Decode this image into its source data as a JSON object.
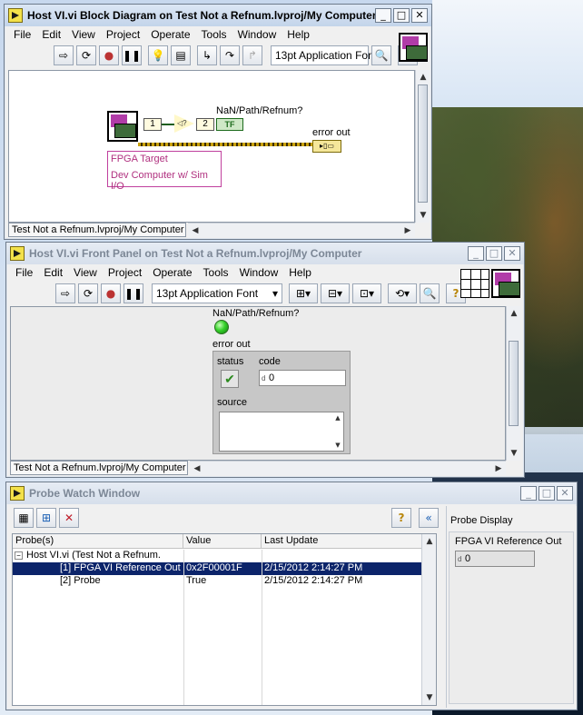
{
  "block_diagram": {
    "title": "Host VI.vi Block Diagram on Test Not a Refnum.lvproj/My Computer",
    "menu": [
      "File",
      "Edit",
      "View",
      "Project",
      "Operate",
      "Tools",
      "Window",
      "Help"
    ],
    "font_select": "13pt Application Font",
    "const_1": "1",
    "const_2": "2",
    "nan_label": "NaN/Path/Refnum?",
    "bool_tf": "TF",
    "error_out_label": "error out",
    "fpga_target_label": "FPGA Target",
    "dev_computer_label": "Dev Computer w/ Sim I/O",
    "status_path": "Test Not a Refnum.lvproj/My Computer"
  },
  "front_panel": {
    "title": "Host VI.vi Front Panel on Test Not a Refnum.lvproj/My Computer",
    "menu": [
      "File",
      "Edit",
      "View",
      "Project",
      "Operate",
      "Tools",
      "Window",
      "Help"
    ],
    "font_select": "13pt Application Font",
    "nan_label": "NaN/Path/Refnum?",
    "error_out_label": "error out",
    "status_label": "status",
    "code_label": "code",
    "code_value": "0",
    "source_label": "source",
    "status_path": "Test Not a Refnum.lvproj/My Computer"
  },
  "probe_watch": {
    "title": "Probe Watch Window",
    "columns": [
      "Probe(s)",
      "Value",
      "Last Update"
    ],
    "rows": [
      {
        "probe": "Host VI.vi (Test Not a Refnum.",
        "value": "",
        "updated": ""
      },
      {
        "probe": "[1] FPGA VI Reference Out",
        "value": "0x2F00001F",
        "updated": "2/15/2012 2:14:27 PM"
      },
      {
        "probe": "[2] Probe",
        "value": "True",
        "updated": "2/15/2012 2:14:27 PM"
      }
    ],
    "probe_display_label": "Probe Display",
    "fpga_ref_label": "FPGA VI Reference Out",
    "fpga_ref_value": "0"
  }
}
